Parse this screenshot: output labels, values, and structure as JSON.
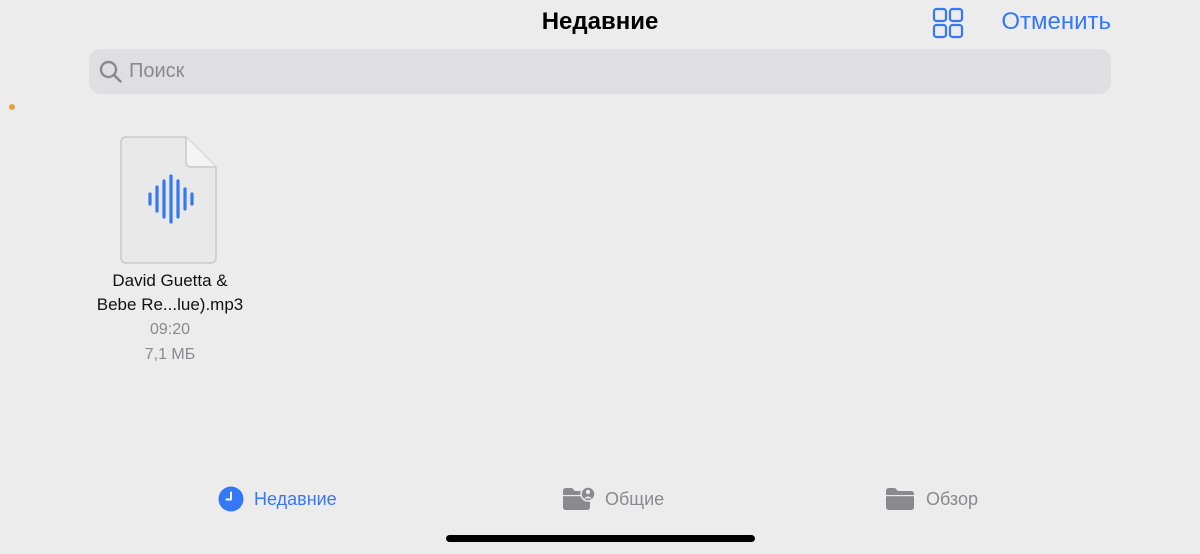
{
  "header": {
    "title": "Недавние",
    "cancel_label": "Отменить"
  },
  "search": {
    "placeholder": "Поиск",
    "value": ""
  },
  "files": [
    {
      "name_line1": "David Guetta &",
      "name_line2": "Bebe Re...lue).mp3",
      "time": "09:20",
      "size": "7,1 МБ",
      "icon": "audio-waveform-icon"
    }
  ],
  "tabs": [
    {
      "label": "Недавние",
      "icon": "clock-icon",
      "active": true
    },
    {
      "label": "Общие",
      "icon": "shared-folder-icon",
      "active": false
    },
    {
      "label": "Обзор",
      "icon": "folder-icon",
      "active": false
    }
  ],
  "colors": {
    "accent": "#3478f6",
    "background": "#ececec",
    "search_background": "#dfdfe1",
    "inactive": "#8a8a8e",
    "dot": "#f0a030"
  }
}
